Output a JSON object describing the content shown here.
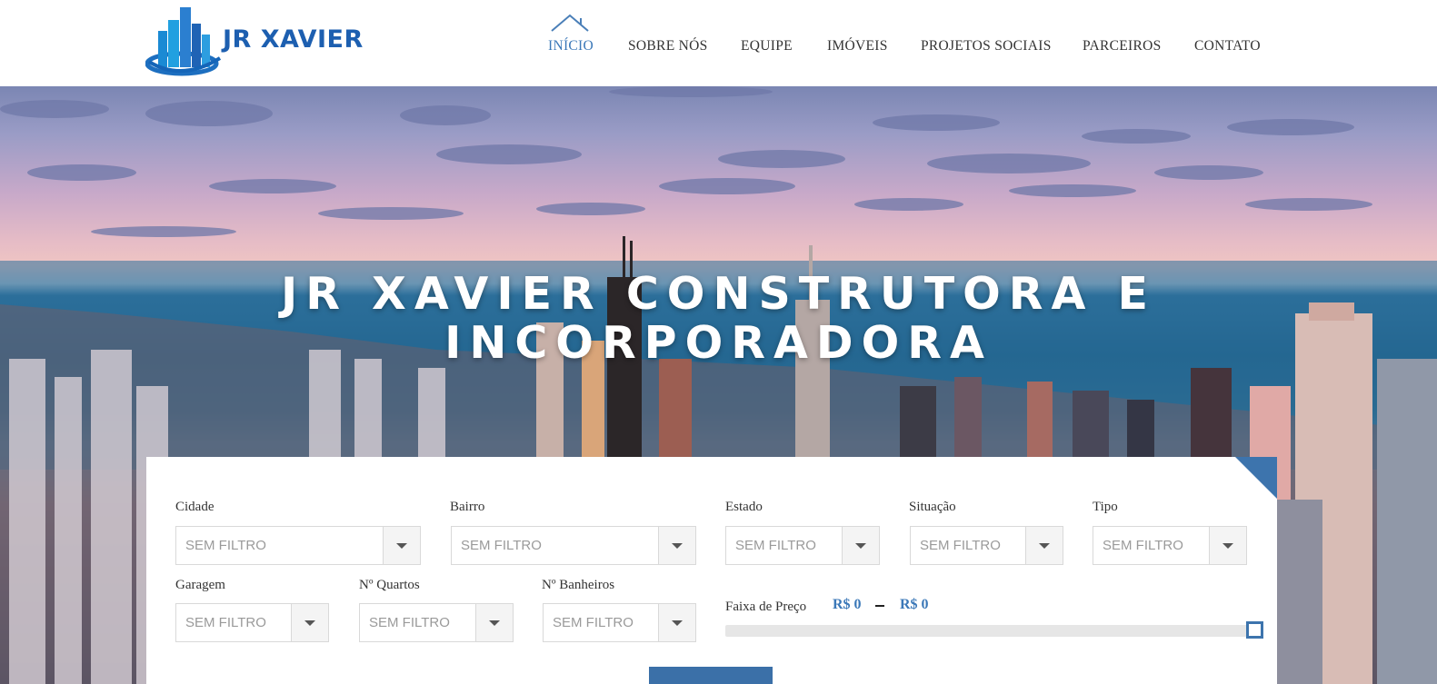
{
  "brand": {
    "name": "JR XAVIER"
  },
  "nav": {
    "items": [
      {
        "label": "INÍCIO",
        "active": true
      },
      {
        "label": "SOBRE NÓS"
      },
      {
        "label": "EQUIPE"
      },
      {
        "label": "IMÓVEIS"
      },
      {
        "label": "PROJETOS SOCIAIS"
      },
      {
        "label": "PARCEIROS"
      },
      {
        "label": "CONTATO"
      }
    ]
  },
  "hero": {
    "title_line1": "JR XAVIER CONSTRUTORA E",
    "title_line2": "INCORPORADORA"
  },
  "search": {
    "filters": [
      {
        "label": "Cidade",
        "value": "SEM FILTRO"
      },
      {
        "label": "Bairro",
        "value": "SEM FILTRO"
      },
      {
        "label": "Estado",
        "value": "SEM FILTRO"
      },
      {
        "label": "Situação",
        "value": "SEM FILTRO"
      },
      {
        "label": "Tipo",
        "value": "SEM FILTRO"
      },
      {
        "label": "Garagem",
        "value": "SEM FILTRO"
      },
      {
        "label": "Nº Quartos",
        "value": "SEM FILTRO"
      },
      {
        "label": "Nº Banheiros",
        "value": "SEM FILTRO"
      }
    ],
    "price": {
      "label": "Faixa de Preço",
      "min": "R$ 0",
      "max": "R$ 0",
      "slider_position": 1.0
    }
  },
  "colors": {
    "accent": "#3b78b8",
    "brand": "#1d5fb0",
    "panel_corner": "#3d74ad"
  }
}
